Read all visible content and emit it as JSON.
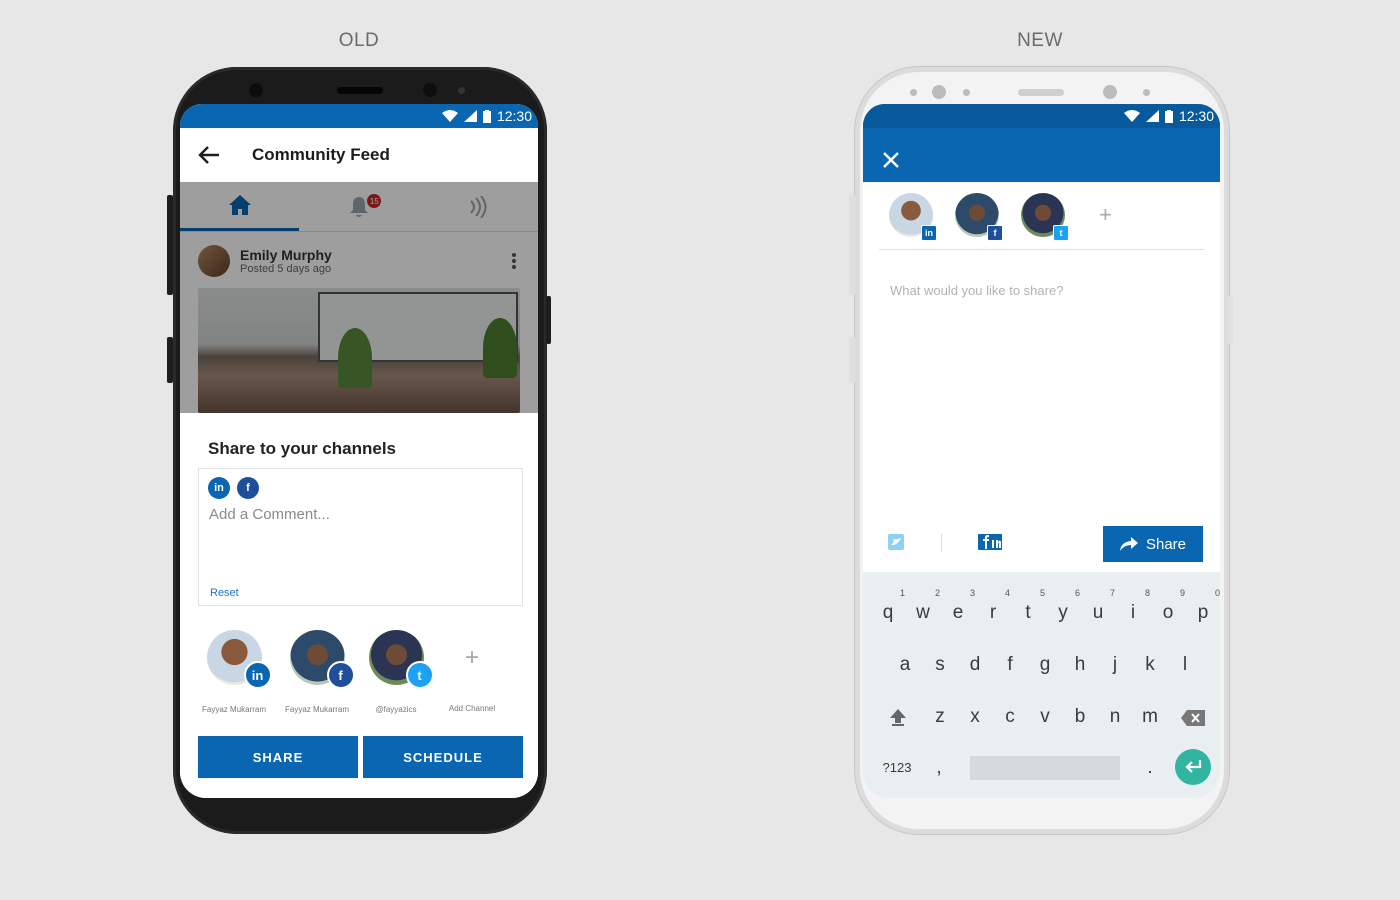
{
  "labels": {
    "old": "OLD",
    "new": "NEW"
  },
  "status_time": "12:30",
  "old": {
    "appbar_title": "Community Feed",
    "notification_count": "15",
    "post": {
      "author": "Emily Murphy",
      "posted": "Posted 5 days ago"
    },
    "sheet_title": "Share to your channels",
    "comment_placeholder": "Add a Comment...",
    "reset_label": "Reset",
    "channels": [
      {
        "name": "Fayyaz Mukarram",
        "network": "in",
        "color": "#0a66b0"
      },
      {
        "name": "Fayyaz Mukarram",
        "network": "f",
        "color": "#1f4e9a"
      },
      {
        "name": "@fayyazics",
        "network": "t",
        "color": "#1da1f2"
      },
      {
        "name": "Add Channel",
        "network": "+"
      }
    ],
    "share_label": "SHARE",
    "schedule_label": "SCHEDULE"
  },
  "new": {
    "close_icon": "close-icon",
    "channel_networks": [
      "in",
      "f",
      "t"
    ],
    "placeholder": "What would you like to share?",
    "share_label": "Share",
    "keyboard": {
      "row1": [
        "q",
        "w",
        "e",
        "r",
        "t",
        "y",
        "u",
        "i",
        "o",
        "p"
      ],
      "row1_hints": [
        "1",
        "2",
        "3",
        "4",
        "5",
        "6",
        "7",
        "8",
        "9",
        "0"
      ],
      "row2": [
        "a",
        "s",
        "d",
        "f",
        "g",
        "h",
        "j",
        "k",
        "l"
      ],
      "row3": [
        "z",
        "x",
        "c",
        "v",
        "b",
        "n",
        "m"
      ],
      "sym_label": "?123",
      "comma": ",",
      "period": "."
    }
  },
  "colors": {
    "brand_blue": "#0a66b0",
    "twitter": "#1da1f2",
    "facebook": "#1f4e9a",
    "enter": "#31b4a0"
  }
}
